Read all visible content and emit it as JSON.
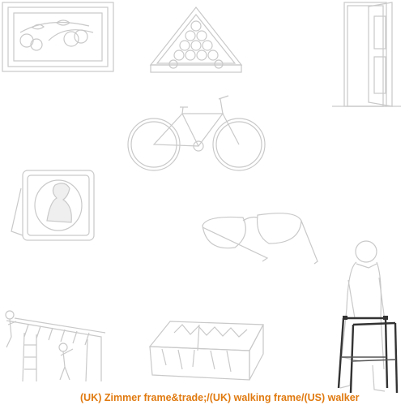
{
  "caption": {
    "text": "(UK) Zimmer frame&trade;/(UK) walking frame/(US) walker"
  },
  "colors": {
    "caption": "#e07a10",
    "faded_line": "#c9c9c9",
    "highlight_frame": "#333333"
  },
  "items": [
    {
      "name": "framed-fruit-picture",
      "highlighted": false
    },
    {
      "name": "billiard-ball-rack",
      "highlighted": false
    },
    {
      "name": "open-door",
      "highlighted": false
    },
    {
      "name": "bicycle",
      "highlighted": false
    },
    {
      "name": "portrait-photo-frame",
      "highlighted": false
    },
    {
      "name": "eyeglasses",
      "highlighted": false
    },
    {
      "name": "climbing-frame",
      "highlighted": false
    },
    {
      "name": "plant-window-box",
      "highlighted": false
    },
    {
      "name": "elderly-man-with-walking-frame",
      "highlighted": true
    }
  ]
}
